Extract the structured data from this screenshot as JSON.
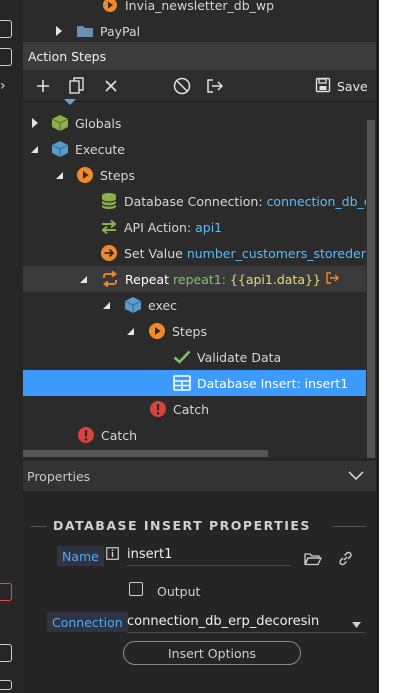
{
  "top_tree": {
    "partial_item": "Invia_newsletter_db_wp",
    "paypal_label": "PayPal"
  },
  "action_steps": {
    "title": "Action Steps",
    "save_label": "Save"
  },
  "tree": {
    "partial_label": "",
    "globals": "Globals",
    "execute": "Execute",
    "steps": "Steps",
    "db_conn_label": "Database Connection:",
    "db_conn_value": "connection_db_erp_",
    "api_label": "API Action:",
    "api_value": "api1",
    "setvalue_label": "Set Value",
    "setvalue_value": "number_customers_storeden",
    "setvalue_suffix": "= (",
    "repeat_label": "Repeat",
    "repeat_name": "repeat1:",
    "repeat_expr": "{{api1.data}}",
    "exec": "exec",
    "steps2": "Steps",
    "validate": "Validate Data",
    "db_insert": "Database Insert: insert1",
    "catch_inner": "Catch",
    "catch_outer": "Catch"
  },
  "properties": {
    "header": "Properties",
    "section_title": "DATABASE INSERT PROPERTIES",
    "name_label": "Name",
    "name_value": "insert1",
    "output_label": "Output",
    "connection_label": "Connection",
    "connection_value": "connection_db_erp_decoresin",
    "insert_options_label": "Insert Options"
  },
  "colors": {
    "accent_blue": "#3d9bff",
    "value_blue": "#4fc1ff",
    "expr_yellow": "#e6db74",
    "orange": "#f08a2a",
    "green": "#7ec26c",
    "red": "#d9433c"
  }
}
